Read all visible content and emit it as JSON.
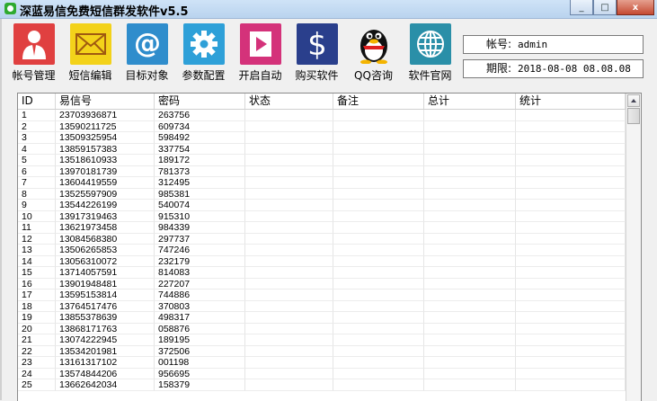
{
  "window": {
    "title": "深蓝易信免费短信群发软件v5.5",
    "minimize": "_",
    "maximize": "□",
    "close": "x"
  },
  "toolbar": [
    {
      "label": "帐号管理",
      "icon": "user-manager-icon",
      "color": "#e04040"
    },
    {
      "label": "短信编辑",
      "icon": "envelope-icon",
      "color": "#f3d21a"
    },
    {
      "label": "目标对象",
      "icon": "at-sign-icon",
      "color": "#2f8dcc"
    },
    {
      "label": "参数配置",
      "icon": "gear-icon",
      "color": "#2ea0d8"
    },
    {
      "label": "开启自动",
      "icon": "play-icon",
      "color": "#d4327a"
    },
    {
      "label": "购买软件",
      "icon": "dollar-icon",
      "color": "#2a3f8c"
    },
    {
      "label": "QQ咨询",
      "icon": "qq-penguin-icon",
      "color": "#e8e8e8"
    },
    {
      "label": "软件官网",
      "icon": "globe-icon",
      "color": "#2a8fa8"
    }
  ],
  "account": {
    "label": "帐号:",
    "value": "admin"
  },
  "expiry": {
    "label": "期限:",
    "value": "2018-08-08 08.08.08"
  },
  "table": {
    "columns": [
      "ID",
      "易信号",
      "密码",
      "状态",
      "备注",
      "总计",
      "统计"
    ],
    "rows": [
      [
        "1",
        "23703936871",
        "263756"
      ],
      [
        "2",
        "13590211725",
        "609734"
      ],
      [
        "3",
        "13509325954",
        "598492"
      ],
      [
        "4",
        "13859157383",
        "337754"
      ],
      [
        "5",
        "13518610933",
        "189172"
      ],
      [
        "6",
        "13970181739",
        "781373"
      ],
      [
        "7",
        "13604419559",
        "312495"
      ],
      [
        "8",
        "13525597909",
        "985381"
      ],
      [
        "9",
        "13544226199",
        "540074"
      ],
      [
        "10",
        "13917319463",
        "915310"
      ],
      [
        "11",
        "13621973458",
        "984339"
      ],
      [
        "12",
        "13084568380",
        "297737"
      ],
      [
        "13",
        "13506265853",
        "747246"
      ],
      [
        "14",
        "13056310072",
        "232179"
      ],
      [
        "15",
        "13714057591",
        "814083"
      ],
      [
        "16",
        "13901948481",
        "227207"
      ],
      [
        "17",
        "13595153814",
        "744886"
      ],
      [
        "18",
        "13764517476",
        "370803"
      ],
      [
        "19",
        "13855378639",
        "498317"
      ],
      [
        "20",
        "13868171763",
        "058876"
      ],
      [
        "21",
        "13074222945",
        "189195"
      ],
      [
        "22",
        "13534201981",
        "372506"
      ],
      [
        "23",
        "13161317102",
        "001198"
      ],
      [
        "24",
        "13574844206",
        "956695"
      ],
      [
        "25",
        "13662642034",
        "158379"
      ]
    ]
  }
}
